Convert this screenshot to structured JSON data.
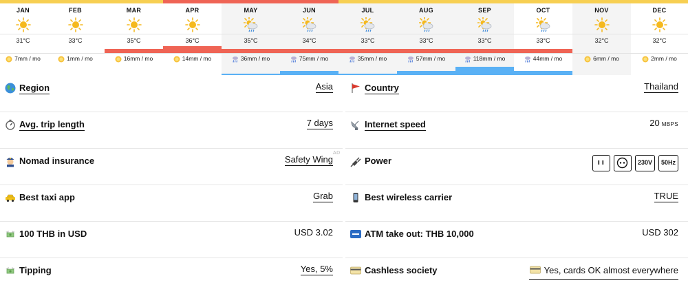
{
  "climate": {
    "months": [
      {
        "name": "JAN",
        "weather_icon": "sun-icon",
        "temp": "31°C",
        "temp_level": "warm",
        "rain": "7mm / mo",
        "rain_icon": "sun-small-icon",
        "rain_level": "low"
      },
      {
        "name": "FEB",
        "weather_icon": "sun-icon",
        "temp": "33°C",
        "temp_level": "warm",
        "rain": "1mm / mo",
        "rain_icon": "sun-small-icon",
        "rain_level": "low"
      },
      {
        "name": "MAR",
        "weather_icon": "sun-icon",
        "temp": "35°C",
        "temp_level": "hot",
        "rain": "16mm / mo",
        "rain_icon": "sun-small-icon",
        "rain_level": "low"
      },
      {
        "name": "APR",
        "weather_icon": "sun-icon",
        "temp": "36°C",
        "temp_level": "very-hot",
        "rain": "14mm / mo",
        "rain_icon": "sun-small-icon",
        "rain_level": "low"
      },
      {
        "name": "MAY",
        "weather_icon": "sun-cloud-rain-icon",
        "temp": "35°C",
        "temp_level": "hot",
        "rain": "36mm / mo",
        "rain_icon": "rain-small-icon",
        "rain_level": "medium"
      },
      {
        "name": "JUN",
        "weather_icon": "sun-cloud-rain-icon",
        "temp": "34°C",
        "temp_level": "hot",
        "rain": "75mm / mo",
        "rain_icon": "rain-small-icon",
        "rain_level": "high"
      },
      {
        "name": "JUL",
        "weather_icon": "sun-cloud-rain-icon",
        "temp": "33°C",
        "temp_level": "hot",
        "rain": "35mm / mo",
        "rain_icon": "rain-small-icon",
        "rain_level": "medium"
      },
      {
        "name": "AUG",
        "weather_icon": "sun-cloud-rain-icon",
        "temp": "33°C",
        "temp_level": "hot",
        "rain": "57mm / mo",
        "rain_icon": "rain-small-icon",
        "rain_level": "high"
      },
      {
        "name": "SEP",
        "weather_icon": "sun-cloud-rain-icon",
        "temp": "33°C",
        "temp_level": "hot",
        "rain": "118mm / mo",
        "rain_icon": "rain-small-icon",
        "rain_level": "very-high"
      },
      {
        "name": "OCT",
        "weather_icon": "sun-cloud-rain-icon",
        "temp": "33°C",
        "temp_level": "hot",
        "rain": "44mm / mo",
        "rain_icon": "rain-small-icon",
        "rain_level": "high"
      },
      {
        "name": "NOV",
        "weather_icon": "sun-icon",
        "temp": "32°C",
        "temp_level": "warm",
        "rain": "6mm / mo",
        "rain_icon": "sun-small-icon",
        "rain_level": "low"
      },
      {
        "name": "DEC",
        "weather_icon": "sun-icon",
        "temp": "32°C",
        "temp_level": "warm",
        "rain": "2mm / mo",
        "rain_icon": "sun-small-icon",
        "rain_level": "low"
      }
    ],
    "colors": {
      "top_warm": "#f7cf52",
      "top_hot": "#ef6455",
      "temp_bar": "#ef6455",
      "rain_bar": "#5ab1f5",
      "sun": "#f5b91e"
    }
  },
  "info": {
    "ad_label": "AD",
    "left": [
      {
        "name": "region",
        "icon": "globe-icon",
        "label": "Region",
        "label_underlined": true,
        "value": "Asia",
        "value_underlined": true
      },
      {
        "name": "avg-trip-length",
        "icon": "stopwatch-icon",
        "label": "Avg. trip length",
        "label_underlined": true,
        "value": "7 days",
        "value_underlined": true
      },
      {
        "name": "nomad-insurance",
        "icon": "police-officer-icon",
        "label": "Nomad insurance",
        "label_underlined": false,
        "value": "Safety Wing",
        "value_underlined": true
      },
      {
        "name": "best-taxi-app",
        "icon": "taxi-icon",
        "label": "Best taxi app",
        "label_underlined": false,
        "value": "Grab",
        "value_underlined": true
      },
      {
        "name": "thb-in-usd",
        "icon": "money-with-wings-icon",
        "label": "100 THB in USD",
        "label_underlined": false,
        "value": "USD 3.02",
        "value_underlined": false
      },
      {
        "name": "tipping",
        "icon": "money-with-wings-icon",
        "label": "Tipping",
        "label_underlined": false,
        "value": "Yes, 5%",
        "value_underlined": true
      }
    ],
    "right": [
      {
        "name": "country",
        "icon": "red-flag-icon",
        "label": "Country",
        "label_underlined": true,
        "value": "Thailand",
        "value_underlined": true
      },
      {
        "name": "internet-speed",
        "icon": "satellite-dish-icon",
        "label": "Internet speed",
        "label_underlined": true,
        "value": "20",
        "unit": "MBPS",
        "value_underlined": false
      },
      {
        "name": "power",
        "icon": "electric-plug-icon",
        "label": "Power",
        "label_underlined": false,
        "plugs": [
          {
            "type": "plug-type-a-icon"
          },
          {
            "type": "plug-type-c-icon"
          },
          {
            "text": "230V"
          },
          {
            "text": "50Hz"
          }
        ]
      },
      {
        "name": "best-wireless-carrier",
        "icon": "mobile-phone-icon",
        "label": "Best wireless carrier",
        "label_underlined": false,
        "value": "TRUE",
        "value_underlined": true
      },
      {
        "name": "atm-take-out",
        "icon": "atm-icon",
        "label": "ATM take out: THB 10,000",
        "label_underlined": false,
        "value": "USD 302",
        "value_underlined": false
      },
      {
        "name": "cashless-society",
        "icon": "credit-card-icon",
        "label": "Cashless society",
        "label_underlined": false,
        "value": "Yes, cards OK almost everywhere",
        "value_icon": "credit-card-icon",
        "value_underlined": true
      }
    ]
  }
}
